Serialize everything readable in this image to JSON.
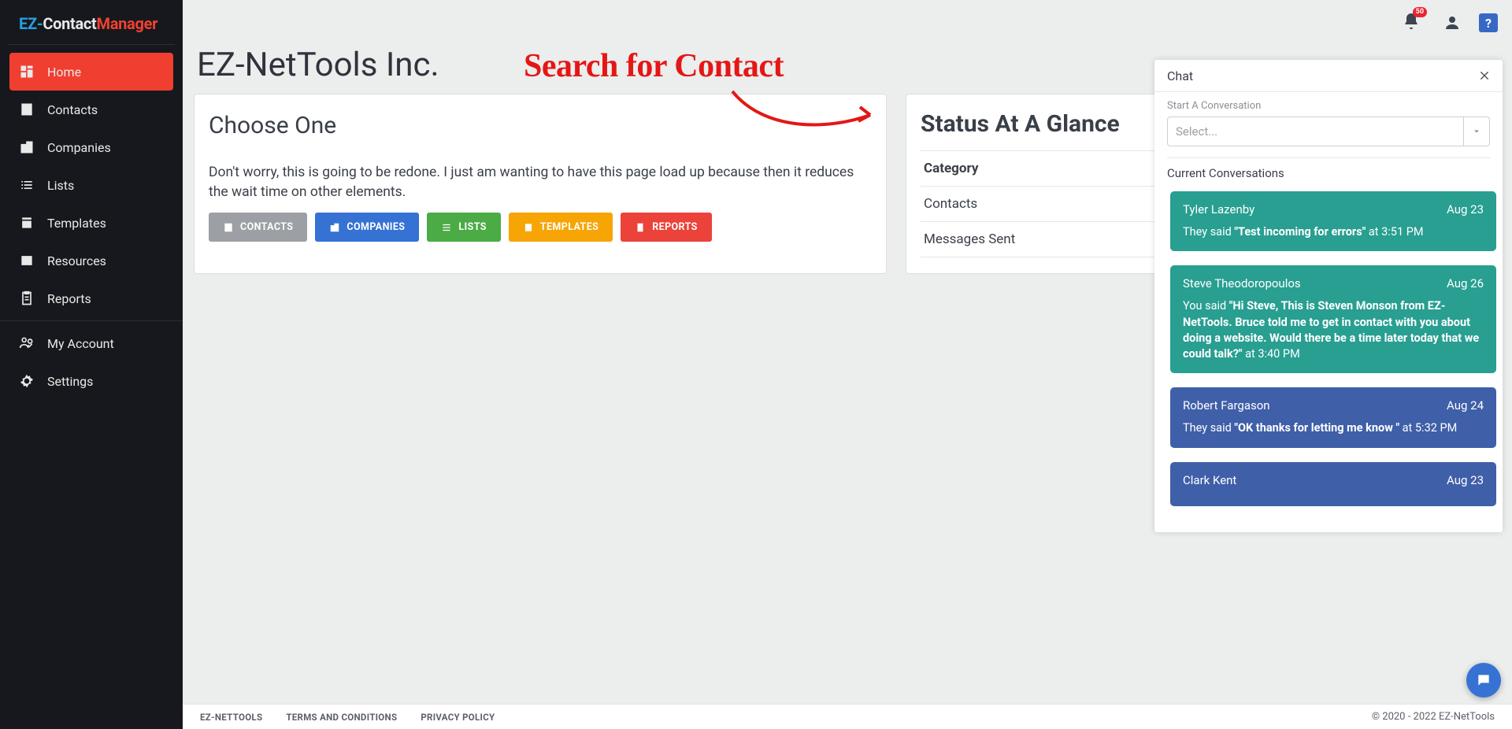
{
  "brand": {
    "ez": "EZ-",
    "contact": "Contact",
    "manager": "Manager"
  },
  "topbar": {
    "badge": "50",
    "help": "?"
  },
  "sidebar": {
    "items": [
      {
        "label": "Home"
      },
      {
        "label": "Contacts"
      },
      {
        "label": "Companies"
      },
      {
        "label": "Lists"
      },
      {
        "label": "Templates"
      },
      {
        "label": "Resources"
      },
      {
        "label": "Reports"
      },
      {
        "label": "My Account"
      },
      {
        "label": "Settings"
      }
    ]
  },
  "page": {
    "title": "EZ-NetTools Inc.",
    "choose_title": "Choose One",
    "disclaimer": "Don't worry, this is going to be redone. I just am wanting to have this page load up because then it reduces the wait time on other elements.",
    "buttons": {
      "contacts": "CONTACTS",
      "companies": "COMPANIES",
      "lists": "LISTS",
      "templates": "TEMPLATES",
      "reports": "REPORTS"
    }
  },
  "status": {
    "title": "Status At A Glance",
    "rows": [
      "Category",
      "Contacts",
      "Messages Sent"
    ]
  },
  "annotation": {
    "title": "Search for Contact"
  },
  "chat": {
    "title": "Chat",
    "start_label": "Start A Conversation",
    "select_placeholder": "Select...",
    "current_label": "Current Conversations",
    "conversations": [
      {
        "name": "Tyler Lazenby",
        "date": "Aug 23",
        "prefix": "They said ",
        "quote": "\"Test incoming for errors\"",
        "suffix": " at 3:51 PM",
        "cls": "teal"
      },
      {
        "name": "Steve Theodoropoulos",
        "date": "Aug 26",
        "prefix": "You said ",
        "quote": "\"Hi Steve, This is Steven Monson from EZ-NetTools. Bruce told me to get in contact with you about doing a website. Would there be a time later today that we could talk?\"",
        "suffix": " at 3:40 PM",
        "cls": "teal"
      },
      {
        "name": "Robert Fargason",
        "date": "Aug 24",
        "prefix": "They said ",
        "quote": "\"OK thanks for letting me know \"",
        "suffix": " at 5:32 PM",
        "cls": "blue"
      },
      {
        "name": "Clark Kent",
        "date": "Aug 23",
        "prefix": "",
        "quote": "",
        "suffix": "",
        "cls": "blue"
      }
    ]
  },
  "footer": {
    "links": [
      "EZ-NETTOOLS",
      "TERMS AND CONDITIONS",
      "PRIVACY POLICY"
    ],
    "copyright": "© 2020 - 2022 EZ-NetTools"
  }
}
